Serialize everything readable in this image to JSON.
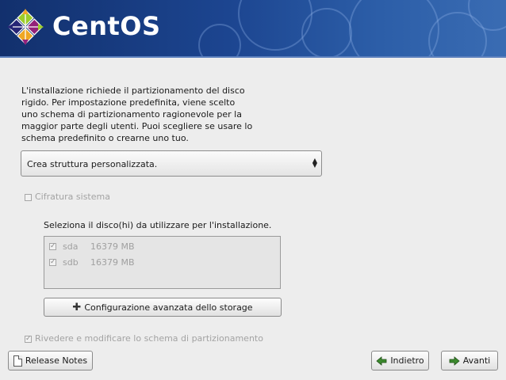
{
  "header": {
    "brand": "CentOS",
    "logo_icon": "centos-logo-icon"
  },
  "description": "L'installazione richiede il partizionamento del disco\nrigido.  Per impostazione predefinita, viene scelto\nuno schema di partizionamento ragionevole per la\nmaggior parte degli utenti.  Puoi scegliere se usare lo\nschema predefinito o crearne uno tuo.",
  "partition_combo": {
    "selected": "Crea struttura personalizzata.",
    "icon": "up-down-arrows-icon"
  },
  "encrypt": {
    "label": "Cifratura sistema",
    "checked": false,
    "enabled": false
  },
  "drives": {
    "label": "Seleziona il disco(hi) da utilizzare per l'installazione.",
    "items": [
      {
        "name": "sda",
        "size": "16379 MB",
        "checked": true
      },
      {
        "name": "sdb",
        "size": "16379 MB",
        "checked": true
      }
    ]
  },
  "advanced_storage": {
    "label": "Configurazione avanzata dello storage",
    "icon": "plus-icon"
  },
  "review": {
    "label": "Rivedere e modificare lo schema di partizionamento",
    "checked": true,
    "enabled": false
  },
  "footer": {
    "release_notes": "Release Notes",
    "back": "Indietro",
    "next": "Avanti"
  },
  "colors": {
    "banner": "#1c4590",
    "background": "#ededed",
    "disabled_text": "#a3a3a3"
  }
}
